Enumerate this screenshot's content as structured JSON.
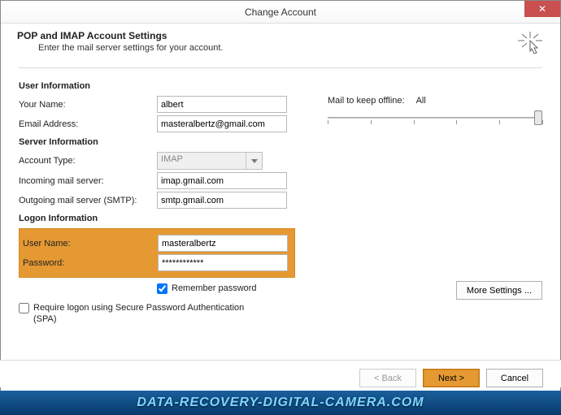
{
  "window": {
    "title": "Change Account",
    "close": "✕"
  },
  "header": {
    "title": "POP and IMAP Account Settings",
    "subtitle": "Enter the mail server settings for your account."
  },
  "sections": {
    "user_info": "User Information",
    "server_info": "Server Information",
    "logon_info": "Logon Information"
  },
  "fields": {
    "your_name": {
      "label": "Your Name:",
      "value": "albert"
    },
    "email": {
      "label": "Email Address:",
      "value": "masteralbertz@gmail.com"
    },
    "account_type": {
      "label": "Account Type:",
      "value": "IMAP"
    },
    "incoming": {
      "label": "Incoming mail server:",
      "value": "imap.gmail.com"
    },
    "outgoing": {
      "label": "Outgoing mail server (SMTP):",
      "value": "smtp.gmail.com"
    },
    "user_name": {
      "label": "User Name:",
      "value": "masteralbertz"
    },
    "password": {
      "label": "Password:",
      "value": "************"
    }
  },
  "checkboxes": {
    "remember": {
      "label": "Remember password",
      "checked": true
    },
    "spa": {
      "label": "Require logon using Secure Password Authentication (SPA)",
      "checked": false
    }
  },
  "offline": {
    "label": "Mail to keep offline:",
    "value": "All"
  },
  "buttons": {
    "more_settings": "More Settings ...",
    "back": "< Back",
    "next": "Next >",
    "cancel": "Cancel"
  },
  "banner": "DATA-RECOVERY-DIGITAL-CAMERA.COM"
}
